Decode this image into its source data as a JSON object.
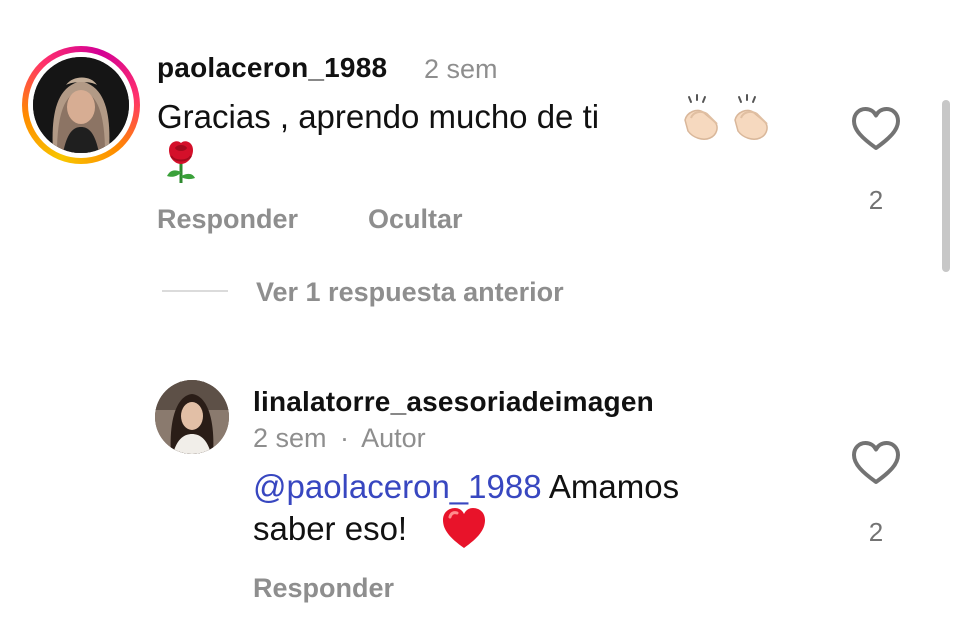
{
  "comments": [
    {
      "username": "paolaceron_1988",
      "time": "2 sem",
      "text": "Gracias , aprendo mucho de ti",
      "emojis_inline": [
        "clapping-hands",
        "clapping-hands"
      ],
      "emoji_second_line": "rose",
      "likes": "2",
      "actions": {
        "reply": "Responder",
        "hide": "Ocultar"
      },
      "has_story_ring": true
    },
    {
      "username": "linalatorre_asesoriadeimagen",
      "time": "2 sem",
      "separator": "·",
      "author_badge": "Autor",
      "mention": "@paolaceron_1988",
      "text_line1": " Amamos",
      "text_line2": "saber eso!",
      "emoji": "red-heart",
      "likes": "2",
      "actions": {
        "reply": "Responder"
      }
    }
  ],
  "view_replies": "Ver 1 respuesta anterior",
  "colors": {
    "mention": "#3847c0",
    "secondary_text": "#8e8e8e",
    "primary_text": "#111111"
  },
  "icons": [
    "heart-outline-icon",
    "clapping-hands-emoji",
    "rose-emoji",
    "red-heart-emoji"
  ]
}
